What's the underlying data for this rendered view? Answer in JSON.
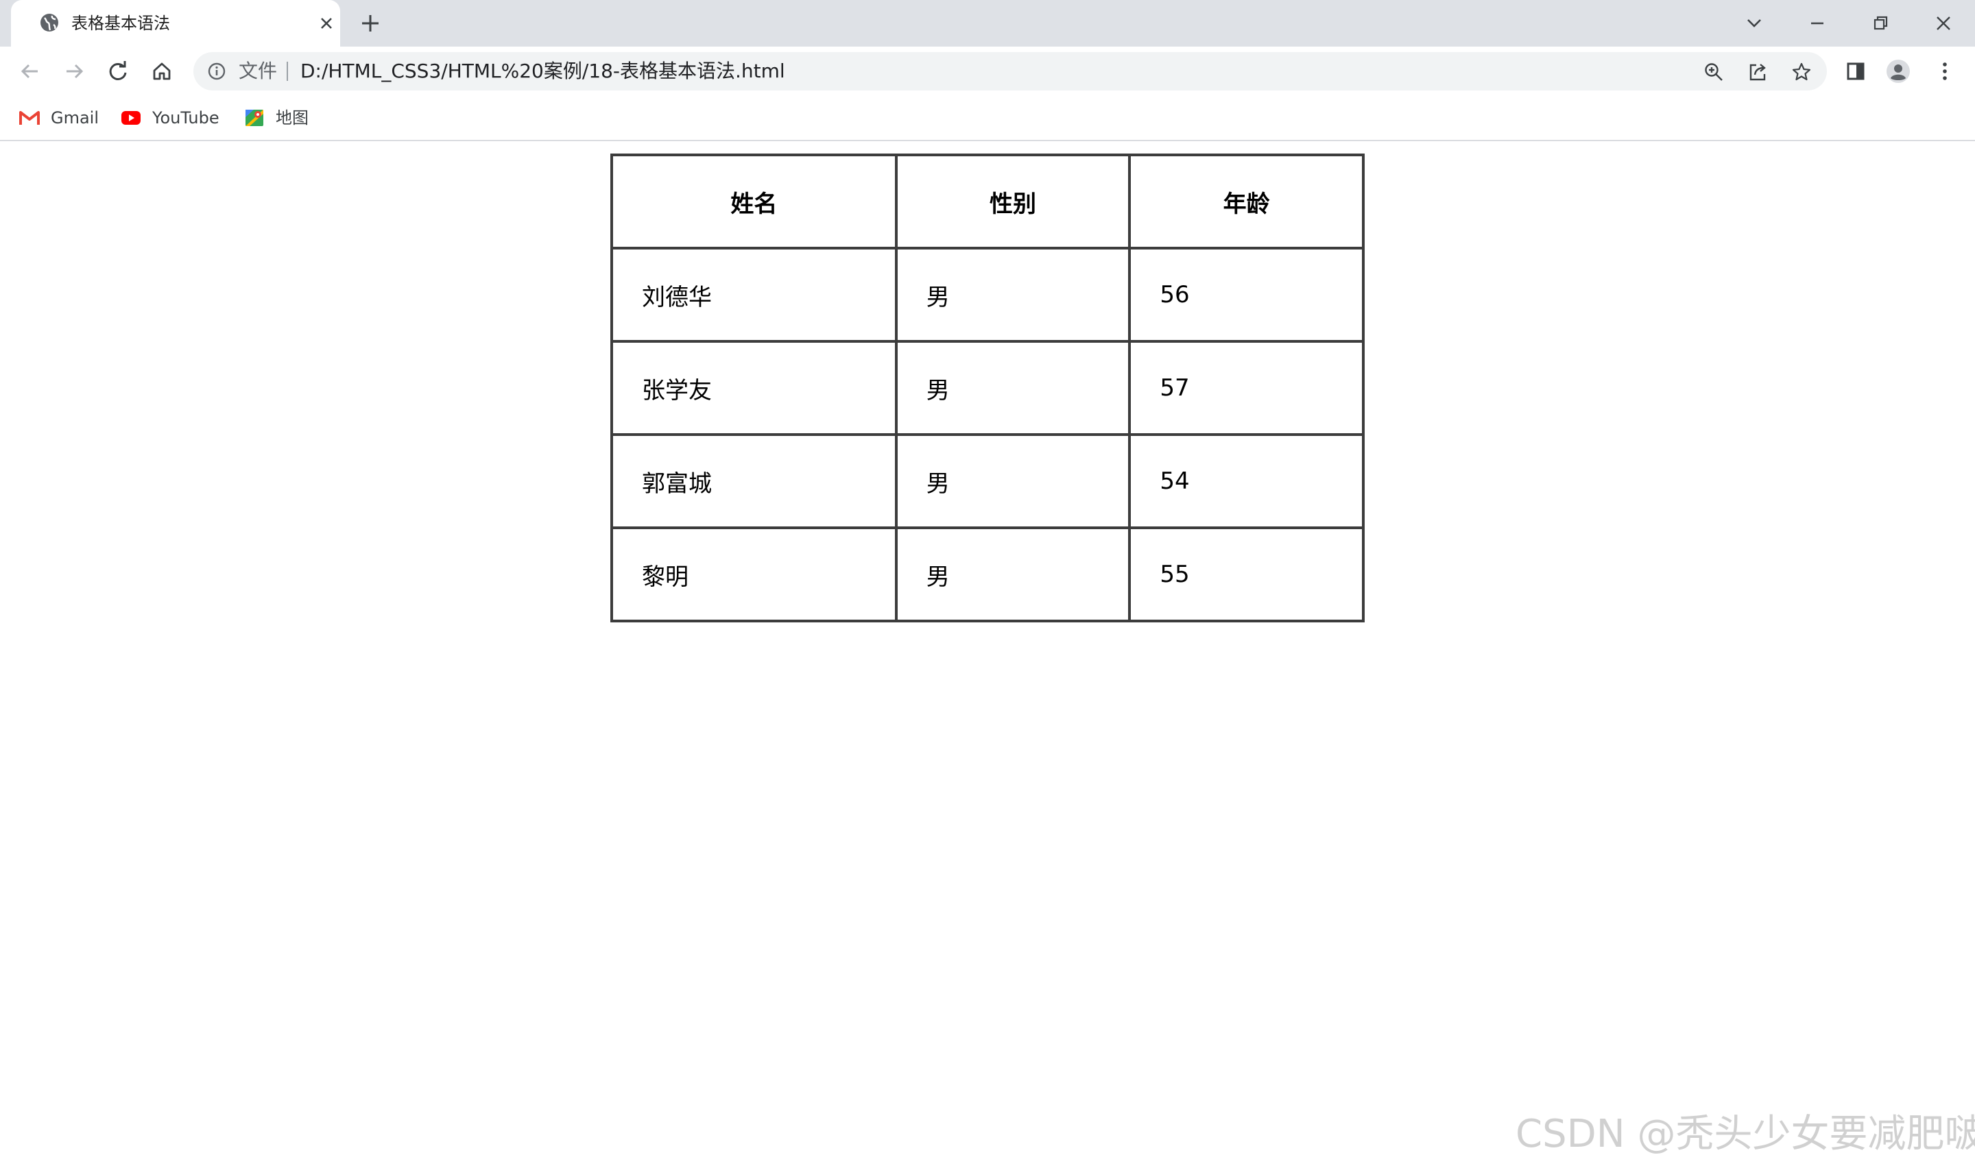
{
  "browser": {
    "tab": {
      "title": "表格基本语法"
    },
    "address": {
      "scheme_label": "文件",
      "url": "D:/HTML_CSS3/HTML%20案例/18-表格基本语法.html"
    },
    "bookmarks": [
      {
        "label": "Gmail",
        "icon": "gmail-icon"
      },
      {
        "label": "YouTube",
        "icon": "youtube-icon"
      },
      {
        "label": "地图",
        "icon": "maps-icon"
      }
    ]
  },
  "table": {
    "headers": [
      "姓名",
      "性别",
      "年龄"
    ],
    "rows": [
      [
        "刘德华",
        "男",
        "56"
      ],
      [
        "张学友",
        "男",
        "57"
      ],
      [
        "郭富城",
        "男",
        "54"
      ],
      [
        "黎明",
        "男",
        "55"
      ]
    ]
  },
  "watermark": "CSDN @秃头少女要减肥啵",
  "colors": {
    "tabstrip_bg": "#dee1e6",
    "omnibox_bg": "#f1f3f4",
    "table_border": "#3c3c3c",
    "gmail_red": "#ea4335",
    "youtube_red": "#ff0000"
  }
}
